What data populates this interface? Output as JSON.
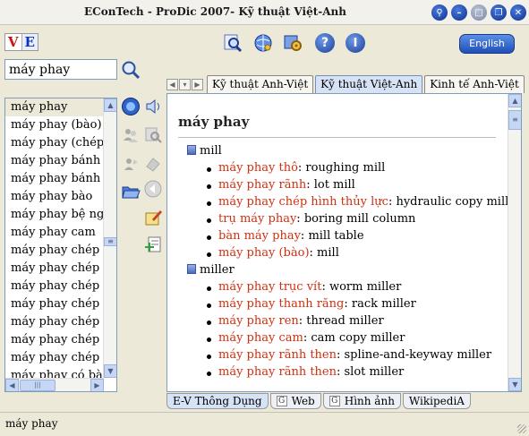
{
  "window": {
    "title": "EConTech - ProDic 2007- Kỹ thuật Việt-Anh"
  },
  "lang_switch": {
    "v": "V",
    "e": "E"
  },
  "toolbar": {
    "english_label": "English",
    "help_label": "?",
    "info_label": "I"
  },
  "search": {
    "value": "máy phay"
  },
  "tabs": [
    {
      "label": "Kỹ thuật Anh-Việt",
      "active": false
    },
    {
      "label": "Kỹ thuật Việt-Anh",
      "active": true
    },
    {
      "label": "Kinh tế Anh-Việt",
      "active": false
    }
  ],
  "word_list": [
    {
      "text": "máy phay",
      "selected": true
    },
    {
      "text": "máy phay (bào)"
    },
    {
      "text": "máy phay (chép"
    },
    {
      "text": "máy phay bánh v"
    },
    {
      "text": "máy phay bánh x"
    },
    {
      "text": "máy phay bào"
    },
    {
      "text": "máy phay bệ nga"
    },
    {
      "text": "máy phay cam"
    },
    {
      "text": "máy phay chép h"
    },
    {
      "text": "máy phay chép h"
    },
    {
      "text": "máy phay chép h"
    },
    {
      "text": "máy phay chép h"
    },
    {
      "text": "máy phay chép h"
    },
    {
      "text": "máy phay chép h"
    },
    {
      "text": "máy phay chép h"
    },
    {
      "text": "máy phay có bàn"
    }
  ],
  "content": {
    "headword": "máy phay",
    "sections": [
      {
        "term": "mill",
        "entries": [
          {
            "vn": "máy phay thô",
            "en": "roughing mill"
          },
          {
            "vn": "máy phay rãnh",
            "en": "lot mill"
          },
          {
            "vn": "máy phay chép hình thủy lực",
            "en": "hydraulic copy mill"
          },
          {
            "vn": "trụ máy phay",
            "en": "boring mill column"
          },
          {
            "vn": "bàn máy phay",
            "en": "mill table"
          },
          {
            "vn": "máy phay (bào)",
            "en": "mill"
          }
        ]
      },
      {
        "term": "miller",
        "entries": [
          {
            "vn": "máy phay trục vít",
            "en": "worm miller"
          },
          {
            "vn": "máy phay thanh răng",
            "en": "rack miller"
          },
          {
            "vn": "máy phay ren",
            "en": "thread miller"
          },
          {
            "vn": "máy phay cam",
            "en": "cam copy miller"
          },
          {
            "vn": "máy phay rãnh then",
            "en": "spline-and-keyway miller"
          },
          {
            "vn": "máy phay rãnh then",
            "en": "slot miller"
          }
        ]
      }
    ]
  },
  "bottom_tabs": [
    {
      "label": "E-V Thông Dụng",
      "icon": false,
      "active": true
    },
    {
      "label": "Web",
      "icon": true
    },
    {
      "label": "Hình ảnh",
      "icon": true
    },
    {
      "label": "WikipediA",
      "icon": false
    }
  ],
  "status": {
    "text": "máy phay"
  },
  "colors": {
    "vn_term": "#d03010",
    "accent": "#1f4fb8"
  }
}
